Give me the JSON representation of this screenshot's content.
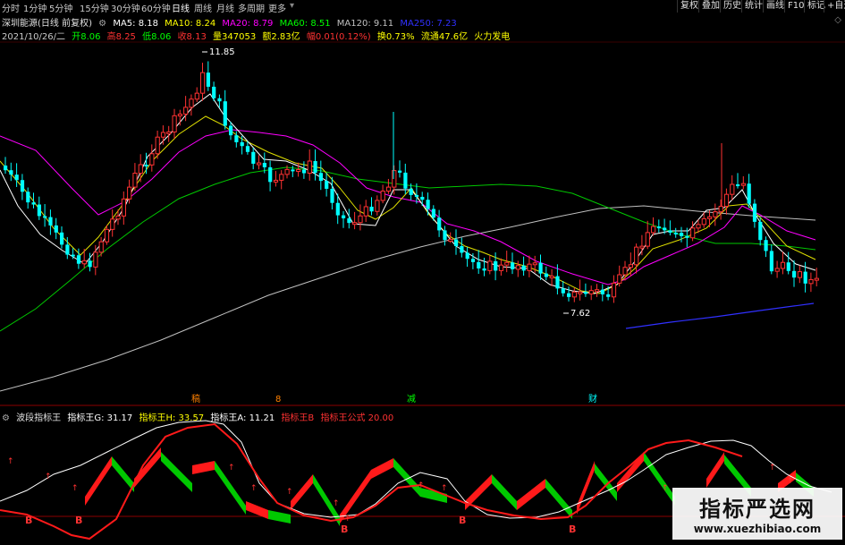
{
  "periods": [
    "分时",
    "1分钟",
    "5分钟",
    "15分钟",
    "30分钟",
    "60分钟",
    "日线",
    "周线",
    "月线",
    "多周期",
    "更多"
  ],
  "active_period": "日线",
  "right_buttons": [
    "复权",
    "叠加",
    "历史",
    "统计",
    "画线",
    "F10",
    "标记",
    "+自选"
  ],
  "header": {
    "title": "深圳能源(日线 前复权)",
    "ma5": "MA5: 8.18",
    "ma10": "MA10: 8.24",
    "ma20": "MA20: 8.79",
    "ma60": "MA60: 8.51",
    "ma120": "MA120: 9.11",
    "ma250": "MA250: 7.23"
  },
  "quote": {
    "date": "2021/10/26/二",
    "open": "开8.06",
    "high": "高8.25",
    "low": "低8.06",
    "close": "收8.13",
    "volume": "量347053",
    "amount": "额2.83亿",
    "change": "幅0.01(0.12%)",
    "turnover": "换0.73%",
    "float_cap": "流通47.6亿",
    "sector": "火力发电"
  },
  "annotations": {
    "high_label": "11.85",
    "low_label": "7.62"
  },
  "event_tags": [
    "稿",
    "8",
    "减",
    "财"
  ],
  "indicator": {
    "name": "波段指标王",
    "g": "指标王G: 31.17",
    "h": "指标王H: 33.57",
    "a": "指标王A: 11.21",
    "b": "指标王B",
    "formula": "指标王公式 20.00"
  },
  "watermark": {
    "line1": "指标严选网",
    "line2": "www.xuezhibiao.com"
  },
  "colors": {
    "up": "#ff3232",
    "down": "#00ffff",
    "ma5": "#ffffff",
    "ma10": "#ffff00",
    "ma20": "#ff00ff",
    "ma60": "#00ff00",
    "ma120": "#c0c0c0",
    "ma250": "#3030ff"
  }
}
